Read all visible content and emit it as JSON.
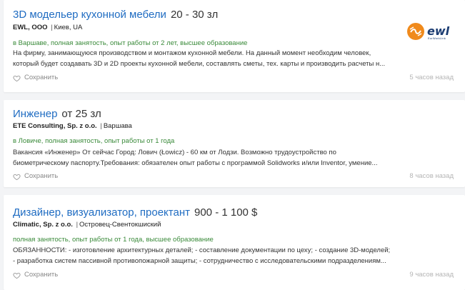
{
  "colors": {
    "title": "#1f6cc2",
    "meta": "#3a8a3a",
    "logo_orange": "#f08a1c",
    "logo_navy": "#1c3d73"
  },
  "jobs": [
    {
      "title": "3D модельер кухонной мебели",
      "salary": "20 - 30 зл",
      "company": "EWL, ООО",
      "separator": "|",
      "city": "Киев, UA",
      "meta": "в Варшаве, полная занятость, опыт работы от 2 лет, высшее образование",
      "description": "На фирму, занимающуюся производством и монтажом кухонной мебели. На данный момент необходим человек, который будет создавать 3D и 2D проекты кухонной мебели, составлять сметы, тех. карты и производить расчеты н...",
      "save_label": "Сохранить",
      "time": "5 часов назад",
      "logo": {
        "name": "ewl-logo",
        "text": "ewl",
        "subtext": "EurWorkLink"
      }
    },
    {
      "title": "Инженер",
      "salary": "от 25 зл",
      "company": "ETE Consulting, Sp. z o.o.",
      "separator": "|",
      "city": "Варшава",
      "meta": "в Ловиче, полная занятость, опыт работы от 1 года",
      "description": "Вакансия «Инженер» От сейчас Город: Лович (Łowicz) - 60 км от Лодзи. Возможно трудоустройство по биометрическому паспорту.Требования: обязателен опыт работы с программой Solidworks и/или Inventor, умение...",
      "save_label": "Сохранить",
      "time": "8 часов назад"
    },
    {
      "title": "Дизайнер, визуализатор, проектант",
      "salary": "900 - 1 100 $",
      "company": "Climatic, Sp. z o.o.",
      "separator": "|",
      "city": "Островец-Свентокшиский",
      "meta": "полная занятость, опыт работы от 1 года, высшее образование",
      "description": "ОБЯЗАННОСТИ: - изготовление архитектурных деталей; - составление документации по цеху; - создание 3D-моделей; - разработка систем пассивной противопожарной защиты; - сотрудничество с исследовательскими подразделениям...",
      "save_label": "Сохранить",
      "time": "9 часов назад"
    }
  ]
}
